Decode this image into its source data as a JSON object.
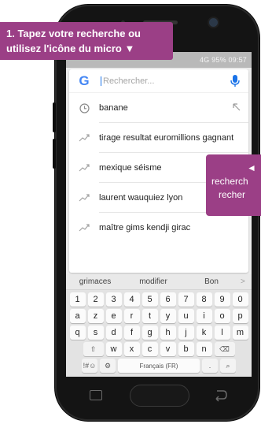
{
  "callouts": {
    "top_line1": "1. Tapez votre recherche ou",
    "top_line2": "utilisez l'icône du micro ▼",
    "right_arrow": "◄",
    "right_line2": "recherch",
    "right_line3": "recher"
  },
  "status_bar": {
    "text": "          4G 95% 09:57"
  },
  "search": {
    "placeholder": "Rechercher...",
    "logo_letter": "G"
  },
  "suggestions": [
    {
      "text": "banane",
      "icon": "history-icon",
      "fill_arrow": true
    },
    {
      "text": "tirage resultat euromillions gagnant",
      "icon": "trending-icon"
    },
    {
      "text": "mexique séisme",
      "icon": "trending-icon"
    },
    {
      "text": "laurent wauquiez lyon",
      "icon": "trending-icon"
    },
    {
      "text": "maître gims kendji girac",
      "icon": "trending-icon"
    }
  ],
  "keyboard": {
    "predictions": [
      "grimaces",
      "modifier",
      "Bon"
    ],
    "predictions_more": ">",
    "row1": [
      "1",
      "2",
      "3",
      "4",
      "5",
      "6",
      "7",
      "8",
      "9",
      "0"
    ],
    "row2": [
      "a",
      "z",
      "e",
      "r",
      "t",
      "y",
      "u",
      "i",
      "o",
      "p"
    ],
    "row3": [
      "q",
      "s",
      "d",
      "f",
      "g",
      "h",
      "j",
      "k",
      "l",
      "m"
    ],
    "row4": [
      "⇧",
      "w",
      "x",
      "c",
      "v",
      "b",
      "n",
      "⌫"
    ],
    "symbols_key": "!#☺",
    "settings_key": "⚙",
    "space_label": "Français (FR)",
    "period_key": ".",
    "search_key": "⌕"
  },
  "colors": {
    "callout": "#9b3f86",
    "google_blue": "#4285f4",
    "mic_blue": "#1a73e8"
  }
}
